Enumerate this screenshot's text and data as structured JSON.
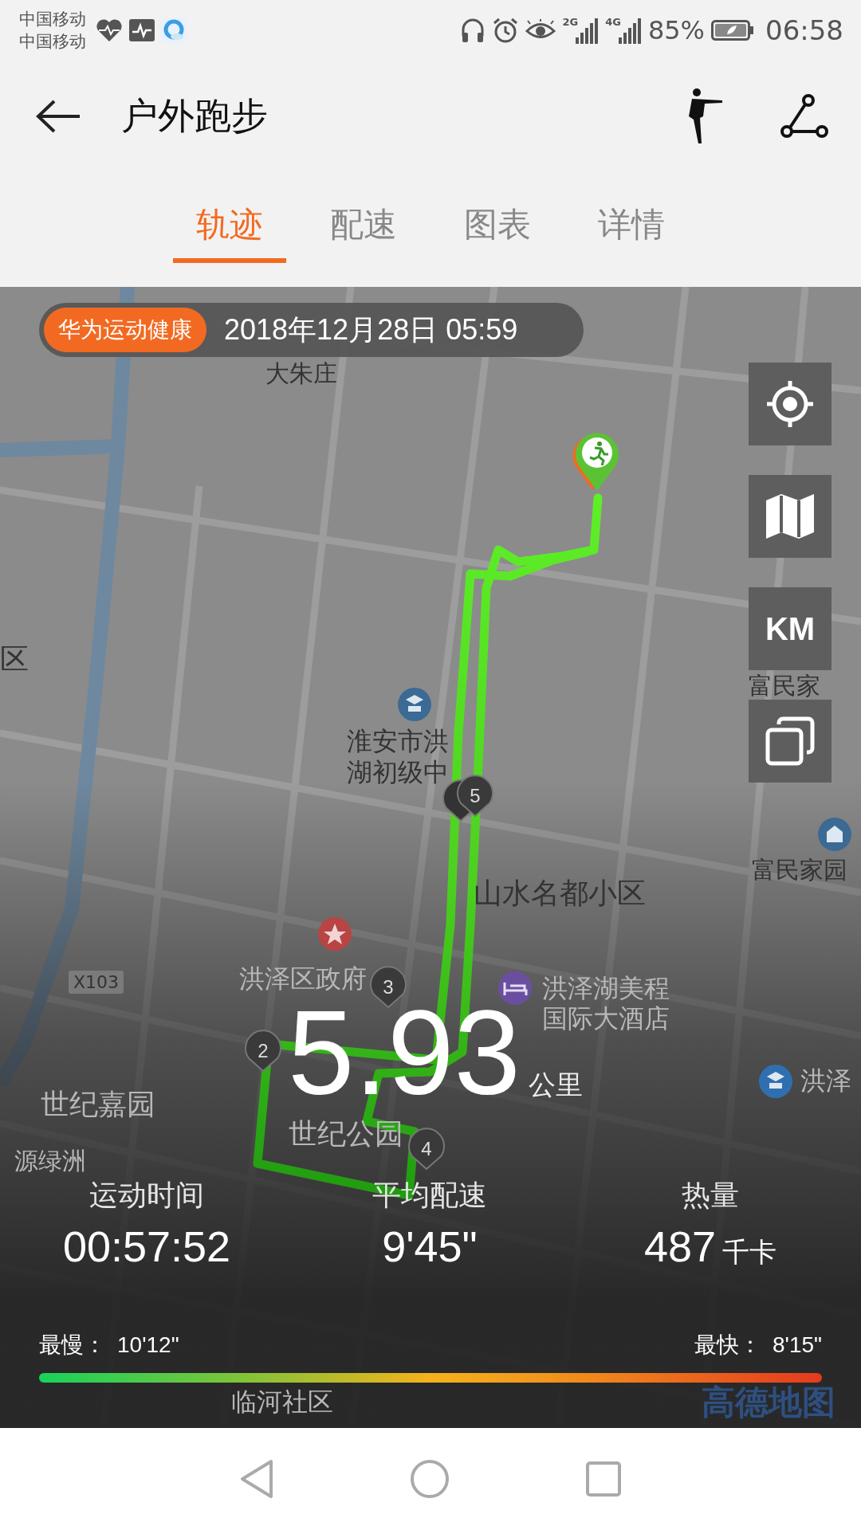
{
  "status_bar": {
    "carriers": [
      "中国移动",
      "中国移动"
    ],
    "network_2g": "2G",
    "network_4g": "4G",
    "battery": "85%",
    "time": "06:58"
  },
  "header": {
    "title": "户外跑步"
  },
  "tabs": [
    {
      "label": "轨迹",
      "selected": true
    },
    {
      "label": "配速",
      "selected": false
    },
    {
      "label": "图表",
      "selected": false
    },
    {
      "label": "详情",
      "selected": false
    }
  ],
  "map": {
    "app_badge": "华为运动健康",
    "date": "2018年12月28日 05:59",
    "controls": [
      {
        "kind": "locate"
      },
      {
        "kind": "map"
      },
      {
        "kind": "unit",
        "label": "KM"
      },
      {
        "kind": "layers"
      }
    ],
    "labels": [
      {
        "kind": "place",
        "text": "大朱庄"
      },
      {
        "kind": "place",
        "text": "区"
      },
      {
        "kind": "place",
        "text": "淮安市洪"
      },
      {
        "kind": "place",
        "text": "湖初级中"
      },
      {
        "kind": "place",
        "text": "富民家"
      },
      {
        "kind": "place",
        "text": "富民家园"
      },
      {
        "kind": "place",
        "text": "山水名都小区"
      },
      {
        "kind": "road",
        "text": "X103"
      },
      {
        "kind": "place",
        "text": "洪泽区政府"
      },
      {
        "kind": "place",
        "text": "洪泽湖美程"
      },
      {
        "kind": "place",
        "text": "国际大酒店"
      },
      {
        "kind": "place",
        "text": "洪泽"
      },
      {
        "kind": "place",
        "text": "世纪嘉园"
      },
      {
        "kind": "place",
        "text": "世纪公园"
      },
      {
        "kind": "place",
        "text": "源绿洲"
      },
      {
        "kind": "place",
        "text": "临河社区"
      }
    ],
    "markers": [
      {
        "label": "5"
      },
      {
        "label": "2"
      },
      {
        "label": "3"
      },
      {
        "label": "4"
      }
    ],
    "logo": "高德地图"
  },
  "summary": {
    "distance": "5.93",
    "distance_unit": "公里",
    "stats": [
      {
        "label": "运动时间",
        "value": "00:57:52"
      },
      {
        "label": "平均配速",
        "value": "9'45\""
      },
      {
        "label": "热量",
        "value": "487",
        "unit": "千卡"
      }
    ],
    "slowest_label": "最慢：",
    "slowest": "10'12\"",
    "fastest_label": "最快：",
    "fastest": "8'15\""
  }
}
